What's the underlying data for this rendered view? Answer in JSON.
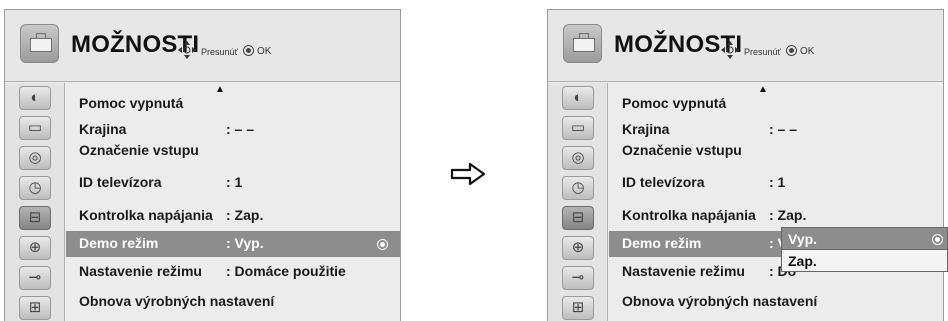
{
  "menu": {
    "title": "MOŽNOSTI",
    "hint_move": "Presunúť",
    "hint_ok": "OK",
    "scroll_up": "▲",
    "categories": [
      {
        "name": "picture",
        "icon": "picture-icon",
        "glyph": "◐"
      },
      {
        "name": "screen",
        "icon": "screen-icon",
        "glyph": "▭"
      },
      {
        "name": "audio",
        "icon": "speaker-icon",
        "glyph": "◎"
      },
      {
        "name": "time",
        "icon": "clock-icon",
        "glyph": "◷"
      },
      {
        "name": "option",
        "icon": "toolbox-icon",
        "glyph": "⊟"
      },
      {
        "name": "lock",
        "icon": "lock-icon",
        "glyph": "⊕"
      },
      {
        "name": "input",
        "icon": "plug-icon",
        "glyph": "⊸"
      },
      {
        "name": "usb",
        "icon": "clapper-icon",
        "glyph": "⊞"
      }
    ],
    "items": [
      {
        "label": "Pomoc vypnutá",
        "value": ""
      },
      {
        "label": "Krajina",
        "value": ": – –"
      },
      {
        "label": "Označenie vstupu",
        "value": ""
      },
      {
        "label": "ID televízora",
        "value": ": 1"
      },
      {
        "label": "Kontrolka napájania",
        "value": ": Zap."
      },
      {
        "label": "Demo režim",
        "value": ": Vyp."
      },
      {
        "label": "Nastavenie režimu",
        "value": ": Domáce použitie"
      },
      {
        "label": "Obnova výrobných nastavení",
        "value": ""
      }
    ]
  },
  "right_values": {
    "demo_partial": ": V",
    "mode_partial": ": Do"
  },
  "dropdown": {
    "options": [
      "Vyp.",
      "Zap."
    ],
    "selected": "Vyp."
  },
  "transition_arrow": "next-step-arrow"
}
